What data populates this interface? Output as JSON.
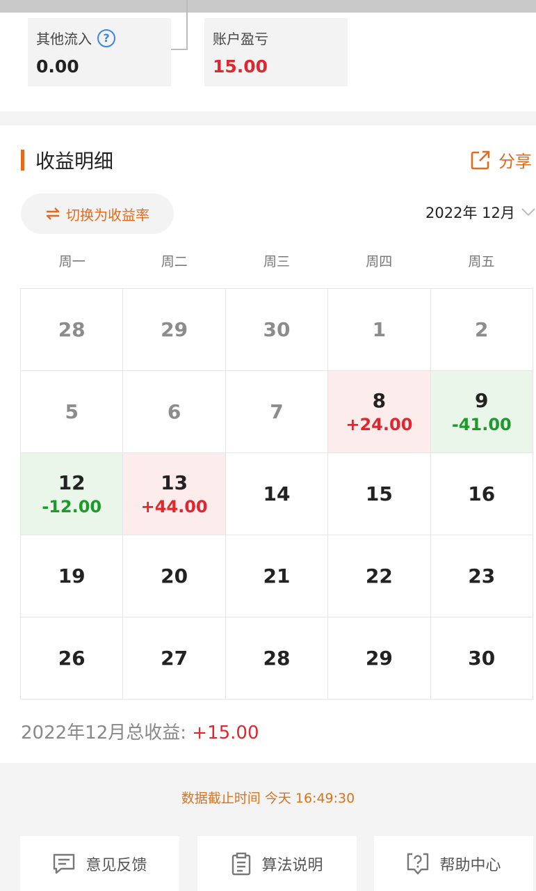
{
  "summary": {
    "other_inflow_label": "其他流入",
    "other_inflow_value": "0.00",
    "account_pnl_label": "账户盈亏",
    "account_pnl_value": "15.00",
    "help_icon": "question-circle-icon"
  },
  "section": {
    "title": "收益明细",
    "share_label": "分享",
    "switch_label": "切换为收益率",
    "month_label": "2022年 12月"
  },
  "weekdays": [
    "周一",
    "周二",
    "周三",
    "周四",
    "周五"
  ],
  "calendar": [
    [
      {
        "day": "28",
        "pnl": ""
      },
      {
        "day": "29",
        "pnl": ""
      },
      {
        "day": "30",
        "pnl": ""
      },
      {
        "day": "1",
        "pnl": ""
      },
      {
        "day": "2",
        "pnl": ""
      }
    ],
    [
      {
        "day": "5",
        "pnl": ""
      },
      {
        "day": "6",
        "pnl": ""
      },
      {
        "day": "7",
        "pnl": ""
      },
      {
        "day": "8",
        "pnl": "+24.00"
      },
      {
        "day": "9",
        "pnl": "-41.00"
      }
    ],
    [
      {
        "day": "12",
        "pnl": "-12.00"
      },
      {
        "day": "13",
        "pnl": "+44.00"
      },
      {
        "day": "14",
        "pnl": ""
      },
      {
        "day": "15",
        "pnl": ""
      },
      {
        "day": "16",
        "pnl": ""
      }
    ],
    [
      {
        "day": "19",
        "pnl": ""
      },
      {
        "day": "20",
        "pnl": ""
      },
      {
        "day": "21",
        "pnl": ""
      },
      {
        "day": "22",
        "pnl": ""
      },
      {
        "day": "23",
        "pnl": ""
      }
    ],
    [
      {
        "day": "26",
        "pnl": ""
      },
      {
        "day": "27",
        "pnl": ""
      },
      {
        "day": "28",
        "pnl": ""
      },
      {
        "day": "29",
        "pnl": ""
      },
      {
        "day": "30",
        "pnl": ""
      }
    ]
  ],
  "total": {
    "label": "2022年12月总收益: ",
    "value": "+15.00"
  },
  "footer": {
    "cutoff": "数据截止时间 今天 16:49:30",
    "feedback_label": "意见反馈",
    "algorithm_label": "算法说明",
    "help_label": "帮助中心"
  },
  "colors": {
    "accent": "#e46a1c",
    "gain": "#e0262e",
    "loss": "#1d9a2a",
    "gain_bg": "#fdecec",
    "loss_bg": "#eaf6ea"
  }
}
